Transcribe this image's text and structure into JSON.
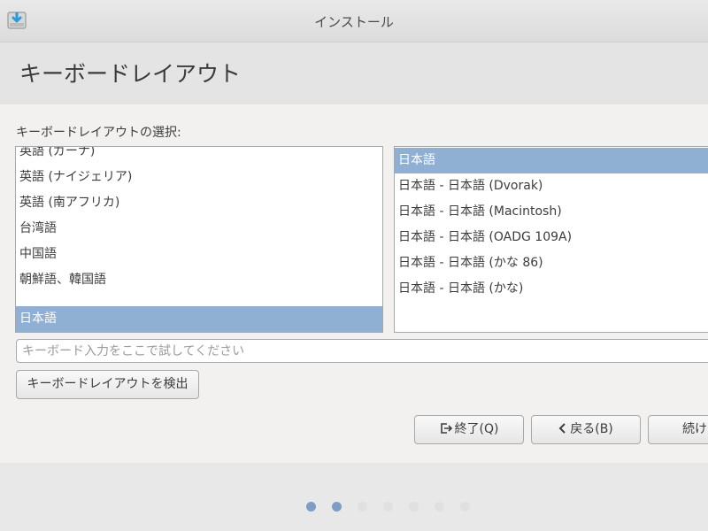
{
  "window": {
    "title": "インストール",
    "icon": "installer-download-icon"
  },
  "header": {
    "title": "キーボードレイアウト"
  },
  "layout_selector": {
    "label": "キーボードレイアウトの選択:",
    "languages": [
      {
        "label": "英語 (ガーナ)",
        "selected": false
      },
      {
        "label": "英語 (ナイジェリア)",
        "selected": false
      },
      {
        "label": "英語 (南アフリカ)",
        "selected": false
      },
      {
        "label": "台湾語",
        "selected": false
      },
      {
        "label": "中国語",
        "selected": false
      },
      {
        "label": "朝鮮語、韓国語",
        "selected": false
      },
      {
        "label": "日本語",
        "selected": true
      }
    ],
    "variants": [
      {
        "label": "日本語",
        "selected": true
      },
      {
        "label": "日本語 - 日本語 (Dvorak)",
        "selected": false
      },
      {
        "label": "日本語 - 日本語 (Macintosh)",
        "selected": false
      },
      {
        "label": "日本語 - 日本語 (OADG 109A)",
        "selected": false
      },
      {
        "label": "日本語 - 日本語 (かな 86)",
        "selected": false
      },
      {
        "label": "日本語 - 日本語 (かな)",
        "selected": false
      }
    ]
  },
  "test_input": {
    "placeholder": "キーボード入力をここで試してください",
    "value": ""
  },
  "buttons": {
    "detect": "キーボードレイアウトを検出",
    "quit": "終了(Q)",
    "back": "戻る(B)",
    "next": "続け"
  },
  "progress": {
    "total_steps": 7,
    "completed_steps": 2
  },
  "colors": {
    "selection": "#8fafd3",
    "dot_active": "#7e9dc6",
    "dot_inactive": "#e0e0e0"
  }
}
